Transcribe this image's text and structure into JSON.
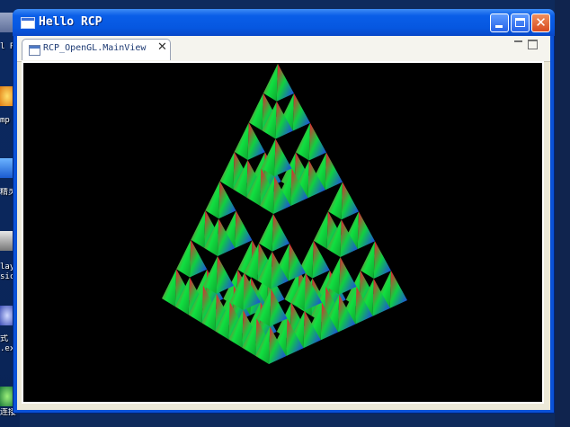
{
  "window": {
    "title": "Hello RCP"
  },
  "titlebar_buttons": {
    "minimize": "minimize-icon",
    "maximize": "maximize-icon",
    "close": "close-icon"
  },
  "view_tab": {
    "label": "RCP_OpenGL.MainView",
    "close_glyph": "✕"
  },
  "desktop_icons": [
    {
      "label": "l P"
    },
    {
      "label": "mp"
    },
    {
      "label": "精灵"
    },
    {
      "label": "lay\nsic"
    },
    {
      "label": "式\n.ex"
    },
    {
      "label": "连接"
    }
  ],
  "colors": {
    "title_blue": "#0a5ee8",
    "canvas_bg": "#000000",
    "pyramid": [
      "#ff1030",
      "#10e040",
      "#2030ff"
    ]
  }
}
